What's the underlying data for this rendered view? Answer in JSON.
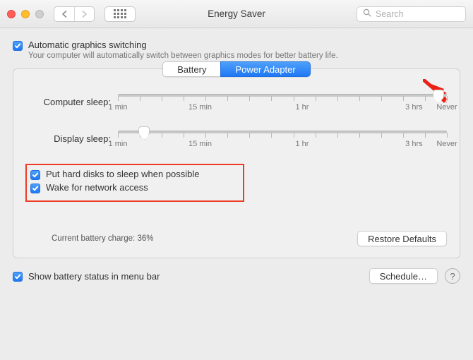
{
  "titlebar": {
    "title": "Energy Saver",
    "search_placeholder": "Search"
  },
  "auto_graphics": {
    "label": "Automatic graphics switching",
    "checked": true,
    "subtext": "Your computer will automatically switch between graphics modes for better battery life."
  },
  "tabs": {
    "battery": "Battery",
    "power_adapter": "Power Adapter",
    "selected": "Power Adapter"
  },
  "sliders": {
    "computer": {
      "label": "Computer sleep:",
      "value_pct": 97.5
    },
    "display": {
      "label": "Display sleep:",
      "value_pct": 8
    },
    "tick_labels": [
      "1 min",
      "15 min",
      "1 hr",
      "3 hrs",
      "Never"
    ],
    "tick_pcts": [
      0,
      25,
      56,
      90,
      100
    ]
  },
  "options": {
    "hard_disks": {
      "label": "Put hard disks to sleep when possible",
      "checked": true
    },
    "wake_net": {
      "label": "Wake for network access",
      "checked": true
    }
  },
  "battery_status": "Current battery charge: 36%",
  "buttons": {
    "restore": "Restore Defaults",
    "schedule": "Schedule…"
  },
  "show_status": {
    "label": "Show battery status in menu bar",
    "checked": true
  }
}
